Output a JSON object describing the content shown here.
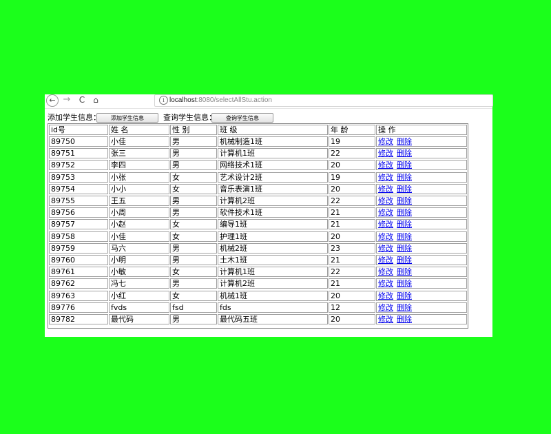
{
  "browser": {
    "nav_back": "←",
    "nav_forward": "→",
    "nav_reload": "C",
    "nav_home": "⌂",
    "info": "i",
    "url_host": "localhost",
    "url_rest": ":8080/selectAllStu.action"
  },
  "toolbar": {
    "add_label": "添加学生信息：",
    "add_button": "添加学生信息",
    "query_label": "查询学生信息：",
    "query_button": "查询学生信息"
  },
  "table": {
    "headers": [
      "id号",
      "姓 名",
      "性 别",
      "班 级",
      "年 龄",
      "操 作"
    ],
    "actions": {
      "edit": "修改",
      "delete": "删除"
    },
    "rows": [
      [
        "89750",
        "小佳",
        "男",
        "机械制造1班",
        "19"
      ],
      [
        "89751",
        "张三",
        "男",
        "计算机1班",
        "22"
      ],
      [
        "89752",
        "李四",
        "男",
        "网络技术1班",
        "20"
      ],
      [
        "89753",
        "小张",
        "女",
        "艺术设计2班",
        "19"
      ],
      [
        "89754",
        "小小",
        "女",
        "音乐表演1班",
        "20"
      ],
      [
        "89755",
        "王五",
        "男",
        "计算机2班",
        "22"
      ],
      [
        "89756",
        "小周",
        "男",
        "软件技术1班",
        "21"
      ],
      [
        "89757",
        "小赵",
        "女",
        "编导1班",
        "21"
      ],
      [
        "89758",
        "小佳",
        "女",
        "护理1班",
        "20"
      ],
      [
        "89759",
        "马六",
        "男",
        "机械2班",
        "23"
      ],
      [
        "89760",
        "小明",
        "男",
        "土木1班",
        "21"
      ],
      [
        "89761",
        "小敏",
        "女",
        "计算机1班",
        "22"
      ],
      [
        "89762",
        "冯七",
        "男",
        "计算机2班",
        "21"
      ],
      [
        "89763",
        "小红",
        "女",
        "机械1班",
        "20"
      ],
      [
        "89776",
        "fvds",
        "fsd",
        "fds",
        "12"
      ],
      [
        "89782",
        "最代码",
        "男",
        "最代码五班",
        "20"
      ]
    ]
  },
  "colors": {
    "background": "#1bff1b",
    "link": "#0000ee"
  }
}
